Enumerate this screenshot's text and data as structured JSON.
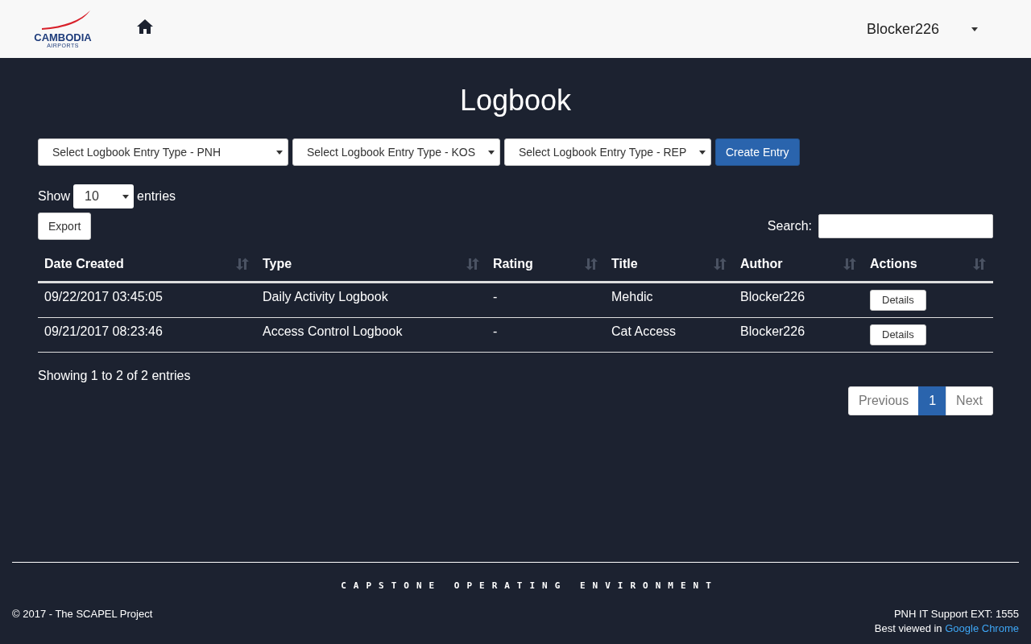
{
  "navbar": {
    "logo": {
      "line1": "CAMBODIA",
      "line2": "AIRPORTS"
    },
    "user": "Blocker226"
  },
  "page": {
    "title": "Logbook"
  },
  "entry_type_selects": [
    {
      "value": "Select Logbook Entry Type - PNH"
    },
    {
      "value": "Select Logbook Entry Type - KOS"
    },
    {
      "value": "Select Logbook Entry Type - REP"
    }
  ],
  "create_button": "Create Entry",
  "length": {
    "label_before": "Show",
    "value": "10",
    "label_after": "entries"
  },
  "export_button": "Export",
  "search": {
    "label": "Search:"
  },
  "table": {
    "columns": [
      "Date Created",
      "Type",
      "Rating",
      "Title",
      "Author",
      "Actions"
    ],
    "rows": [
      {
        "cells": [
          "09/22/2017 03:45:05",
          "Daily Activity Logbook",
          "-",
          "Mehdic",
          "Blocker226"
        ],
        "action": "Details"
      },
      {
        "cells": [
          "09/21/2017 08:23:46",
          "Access Control Logbook",
          "-",
          "Cat Access",
          "Blocker226"
        ],
        "action": "Details"
      }
    ]
  },
  "info": "Showing 1 to 2 of 2 entries",
  "pagination": [
    {
      "label": "Previous",
      "selected": false
    },
    {
      "label": "1",
      "selected": true
    },
    {
      "label": "Next",
      "selected": false
    }
  ],
  "footer": {
    "banner": "CAPSTONE OPERATING ENVIRONMENT",
    "copyright": "© 2017 - The SCAPEL Project",
    "support": "PNH IT Support EXT: 1555",
    "best_viewed": "Best viewed in",
    "browser_link": "Google Chrome"
  }
}
